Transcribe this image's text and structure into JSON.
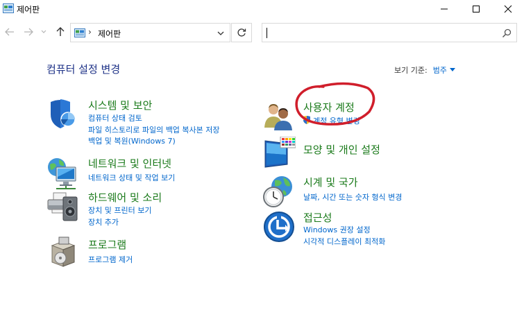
{
  "window": {
    "title": "제어판"
  },
  "address": {
    "separator": "›",
    "crumb": "제어판"
  },
  "search": {
    "placeholder": ""
  },
  "header": {
    "heading": "컴퓨터 설정 변경",
    "view_by_label": "보기 기준:",
    "view_by_value": "범주"
  },
  "categories_left": [
    {
      "name": "security",
      "title": "시스템 및 보안",
      "links": [
        "컴퓨터 상태 검토",
        "파일 히스토리로 파일의 백업 복사본 저장",
        "백업 및 복원(Windows 7)"
      ]
    },
    {
      "name": "network",
      "title": "네트워크 및 인터넷",
      "links": [
        "네트워크 상태 및 작업 보기"
      ]
    },
    {
      "name": "hardware",
      "title": "하드웨어 및 소리",
      "links": [
        "장치 및 프린터 보기",
        "장치 추가"
      ]
    },
    {
      "name": "programs",
      "title": "프로그램",
      "links": [
        "프로그램 제거"
      ]
    }
  ],
  "categories_right": [
    {
      "name": "users",
      "title": "사용자 계정",
      "links": [
        "계정 유형 변경"
      ]
    },
    {
      "name": "appearance",
      "title": "모양 및 개인 설정",
      "links": []
    },
    {
      "name": "clock",
      "title": "시계 및 국가",
      "links": [
        "날짜, 시간 또는 숫자 형식 변경"
      ]
    },
    {
      "name": "ease",
      "title": "접근성",
      "links": [
        "Windows 권장 설정",
        "시각적 디스플레이 최적화"
      ]
    }
  ],
  "colors": {
    "category_title": "#1a7a1a",
    "link": "#0066cc",
    "heading": "#1e3287",
    "annotation": "#d01e2b"
  }
}
